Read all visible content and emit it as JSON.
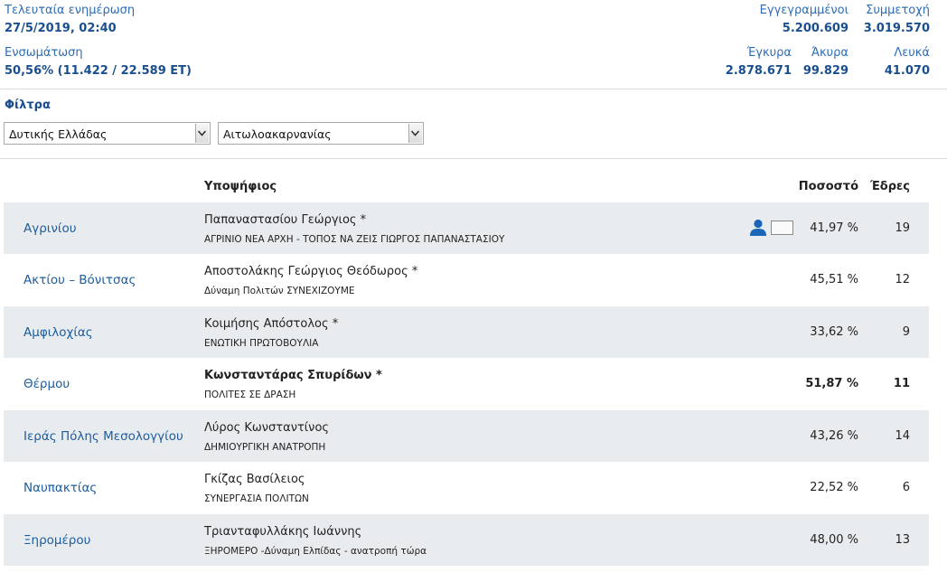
{
  "header": {
    "last_update_label": "Τελευταία ενημέρωση",
    "last_update_value": "27/5/2019, 02:40",
    "integration_label": "Ενσωμάτωση",
    "integration_value": "50,56% (11.422 / 22.589 ΕΤ)",
    "registered_label": "Εγγεγραμμένοι",
    "registered_value": "5.200.609",
    "participation_label": "Συμμετοχή",
    "participation_value": "3.019.570",
    "valid_label": "Έγκυρα",
    "valid_value": "2.878.671",
    "invalid_label": "Άκυρα",
    "invalid_value": "99.829",
    "blank_label": "Λευκά",
    "blank_value": "41.070"
  },
  "filters": {
    "title": "Φίλτρα",
    "region_selected": "Δυτικής Ελλάδας",
    "unit_selected": "Αιτωλοακαρνανίας"
  },
  "table": {
    "headers": {
      "candidate": "Υποψήφιος",
      "percent": "Ποσοστό",
      "seats": "Έδρες"
    },
    "rows": [
      {
        "municipality": "Αγρινίου",
        "candidate": "Παπαναστασίου Γεώργιος *",
        "party": "ΑΓΡΙΝΙΟ ΝΕΑ ΑΡΧΗ - ΤΟΠΟΣ ΝΑ ΖΕΙΣ ΓΙΩΡΓΟΣ ΠΑΠΑΝΑΣΤΑΣΙΟΥ",
        "percent": "41,97 %",
        "seats": "19"
      },
      {
        "municipality": "Ακτίου – Βόνιτσας",
        "candidate": "Αποστολάκης Γεώργιος Θεόδωρος *",
        "party": "Δύναμη Πολιτών ΣΥΝΕΧΙΖΟΥΜΕ",
        "percent": "45,51 %",
        "seats": "12"
      },
      {
        "municipality": "Αμφιλοχίας",
        "candidate": "Κοιμήσης Απόστολος *",
        "party": "ΕΝΩΤΙΚΗ ΠΡΩΤΟΒΟΥΛΙΑ",
        "percent": "33,62 %",
        "seats": "9"
      },
      {
        "municipality": "Θέρμου",
        "candidate": "Κωνσταντάρας Σπυρίδων *",
        "party": "ΠΟΛΙΤΕΣ ΣΕ ΔΡΑΣΗ",
        "percent": "51,87 %",
        "seats": "11"
      },
      {
        "municipality": "Ιεράς Πόλης Μεσολογγίου",
        "candidate": "Λύρος Κωνσταντίνος",
        "party": "ΔΗΜΙΟΥΡΓΙΚΗ ΑΝΑΤΡΟΠΗ",
        "percent": "43,26 %",
        "seats": "14"
      },
      {
        "municipality": "Ναυπακτίας",
        "candidate": "Γκίζας Βασίλειος",
        "party": "ΣΥΝΕΡΓΑΣΙΑ ΠΟΛΙΤΩΝ",
        "percent": "22,52 %",
        "seats": "6"
      },
      {
        "municipality": "Ξηρομέρου",
        "candidate": "Τριανταφυλλάκης Ιωάννης",
        "party": "ΞΗΡΟΜΕΡΟ -Δύναμη Ελπίδας - ανατροπή τώρα",
        "percent": "48,00 %",
        "seats": "13"
      }
    ]
  }
}
